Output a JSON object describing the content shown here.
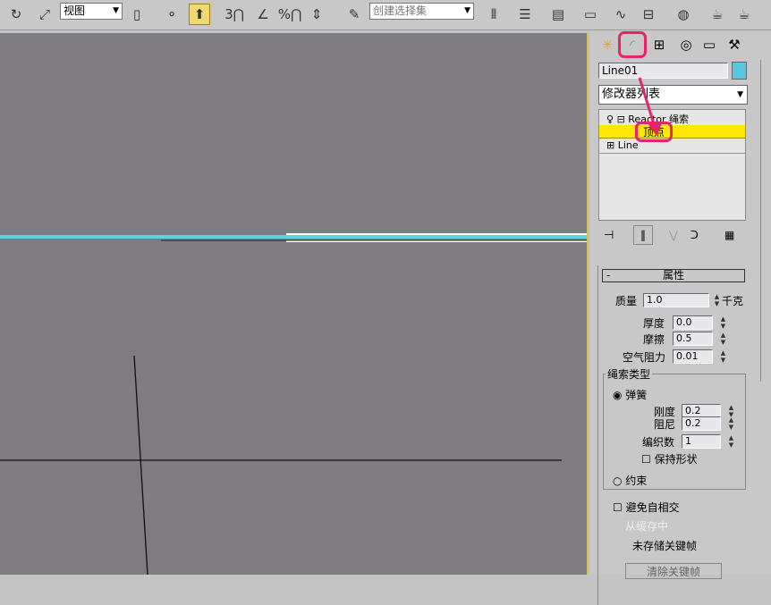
{
  "toolbar": {
    "view_dropdown": "视图",
    "selection_set": "创建选择集",
    "snap_3": "3",
    "snap_pct": "%"
  },
  "panel": {
    "object_name": "Line01",
    "object_color": "#5ac8e0",
    "modifier_list": "修改器列表",
    "stack": [
      {
        "label": "Reactor 绳索"
      },
      {
        "label": "顶点"
      },
      {
        "label": "Line"
      }
    ],
    "properties": {
      "title": "属性",
      "collapse": "-",
      "mass_label": "质量",
      "mass": "1.0",
      "mass_unit": "千克",
      "thickness_label": "厚度",
      "thickness": "0.0",
      "friction_label": "摩擦",
      "friction": "0.5",
      "air_label": "空气阻力",
      "air": "0.01",
      "rope_type": "绳索类型",
      "spring": "弹簧",
      "stiffness_label": "刚度",
      "stiffness": "0.2",
      "damping_label": "阻尼",
      "damping": "0.2",
      "weave_label": "编织数",
      "weave": "1",
      "keep_shape": "保持形状",
      "constraint": "约束",
      "avoid_self": "避免自相交",
      "from_cache": "从缓存中",
      "unstored": "未存储关键帧",
      "clear_keys": "清除关键帧"
    }
  }
}
